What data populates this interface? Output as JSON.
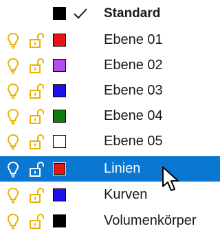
{
  "colors": {
    "selection": "#0a77d3",
    "bulb": "#e8b400",
    "lock": "#e8b400",
    "selected_icon": "#ffffff"
  },
  "header": {
    "name": "Standard",
    "swatch": "#000000",
    "current_icon": "check-icon"
  },
  "layers": [
    {
      "name": "Ebene 01",
      "swatch": "#e81515",
      "visible_icon": "lightbulb-icon",
      "lock_icon": "unlocked-icon",
      "selected": false
    },
    {
      "name": "Ebene 02",
      "swatch": "#b44ee8",
      "visible_icon": "lightbulb-icon",
      "lock_icon": "unlocked-icon",
      "selected": false
    },
    {
      "name": "Ebene 03",
      "swatch": "#1a12ee",
      "visible_icon": "lightbulb-icon",
      "lock_icon": "unlocked-icon",
      "selected": false
    },
    {
      "name": "Ebene 04",
      "swatch": "#137a13",
      "visible_icon": "lightbulb-icon",
      "lock_icon": "unlocked-icon",
      "selected": false
    },
    {
      "name": "Ebene 05",
      "swatch": "#ffffff",
      "visible_icon": "lightbulb-icon",
      "lock_icon": "unlocked-icon",
      "selected": false
    },
    {
      "name": "Linien",
      "swatch": "#e81515",
      "visible_icon": "lightbulb-icon",
      "lock_icon": "unlocked-icon",
      "selected": true
    },
    {
      "name": "Kurven",
      "swatch": "#1a12ee",
      "visible_icon": "lightbulb-icon",
      "lock_icon": "unlocked-icon",
      "selected": false
    },
    {
      "name": "Volumenkörper",
      "swatch": "#000000",
      "visible_icon": "lightbulb-icon",
      "lock_icon": "unlocked-icon",
      "selected": false
    }
  ],
  "pointer": "mouse-pointer-icon"
}
